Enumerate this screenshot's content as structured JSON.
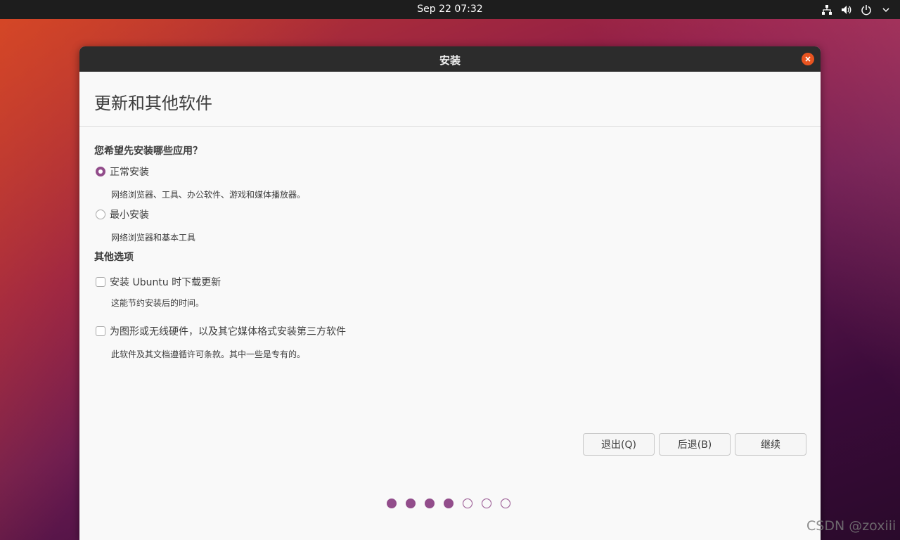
{
  "topbar": {
    "datetime": "Sep 22  07:32",
    "tray_icons": [
      "network-icon",
      "volume-icon",
      "power-icon",
      "chevron-down-icon"
    ]
  },
  "window": {
    "title": "安装",
    "heading": "更新和其他软件"
  },
  "install_type": {
    "question": "您希望先安装哪些应用？",
    "options": [
      {
        "label": "正常安装",
        "description": "网络浏览器、工具、办公软件、游戏和媒体播放器。",
        "selected": true
      },
      {
        "label": "最小安装",
        "description": "网络浏览器和基本工具",
        "selected": false
      }
    ]
  },
  "other_options": {
    "title": "其他选项",
    "items": [
      {
        "label": "安装 Ubuntu 时下载更新",
        "description": "这能节约安装后的时间。",
        "checked": false
      },
      {
        "label": "为图形或无线硬件，以及其它媒体格式安装第三方软件",
        "description": "此软件及其文档遵循许可条款。其中一些是专有的。",
        "checked": false
      }
    ]
  },
  "buttons": {
    "quit": "退出(Q)",
    "back": "后退(B)",
    "continue": "继续"
  },
  "progress": {
    "current_step": 4,
    "total_steps": 7
  },
  "watermark": "CSDN @zoxiii",
  "colors": {
    "accent": "#924d8b",
    "close": "#e95420",
    "titlebar": "#2c2c2c",
    "topbar": "#1d1d1d"
  }
}
